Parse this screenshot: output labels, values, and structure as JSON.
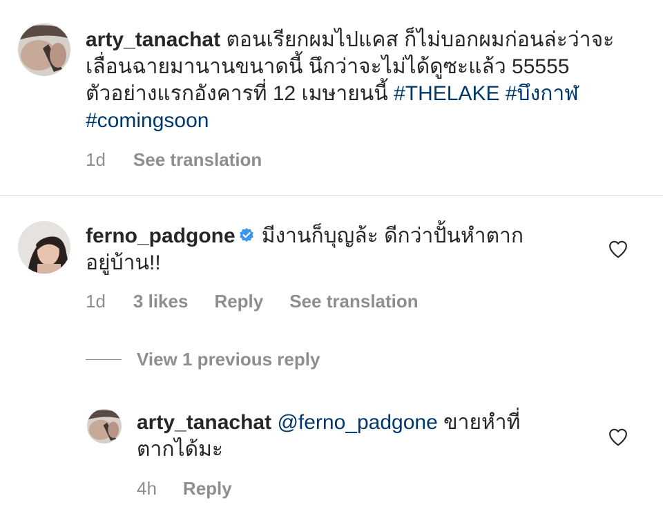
{
  "comment1": {
    "username": "arty_tanachat",
    "text_line1": "ตอนเรียกผมไปแคส ก็ไม่บอกผมก่อนล่ะว่าจะ",
    "text_line2": "เลื่อนฉายมานานขนาดนี้ นึกว่าจะไม่ได้ดูซะแล้ว 55555",
    "text_line3": "ตัวอย่างแรกอังคารที่ 12 เมษายนนี้ ",
    "hashtag1": "#THELAKE",
    "hashtag2": "#บึงกาฬ",
    "hashtag3": "#comingsoon",
    "time": "1d",
    "see_translation": "See translation"
  },
  "comment2": {
    "username": "ferno_padgone",
    "verified_icon": "verified-badge-icon",
    "text_line1": "มีงานก็บุญล้ะ ดีกว่าปั้นหำตาก",
    "text_line2": "อยู่บ้าน!!",
    "time": "1d",
    "likes": "3 likes",
    "reply": "Reply",
    "see_translation": "See translation"
  },
  "view_replies": {
    "label": "View 1 previous reply"
  },
  "reply1": {
    "username": "arty_tanachat",
    "mention": "@ferno_padgone",
    "text_line1": " ขายหำที่",
    "text_line2": "ตากได้มะ",
    "time": "4h",
    "reply": "Reply"
  },
  "colors": {
    "text": "#262626",
    "secondary": "#8e8e8e",
    "link": "#00376b",
    "verified": "#3897f0",
    "divider": "#dbdbdb"
  }
}
